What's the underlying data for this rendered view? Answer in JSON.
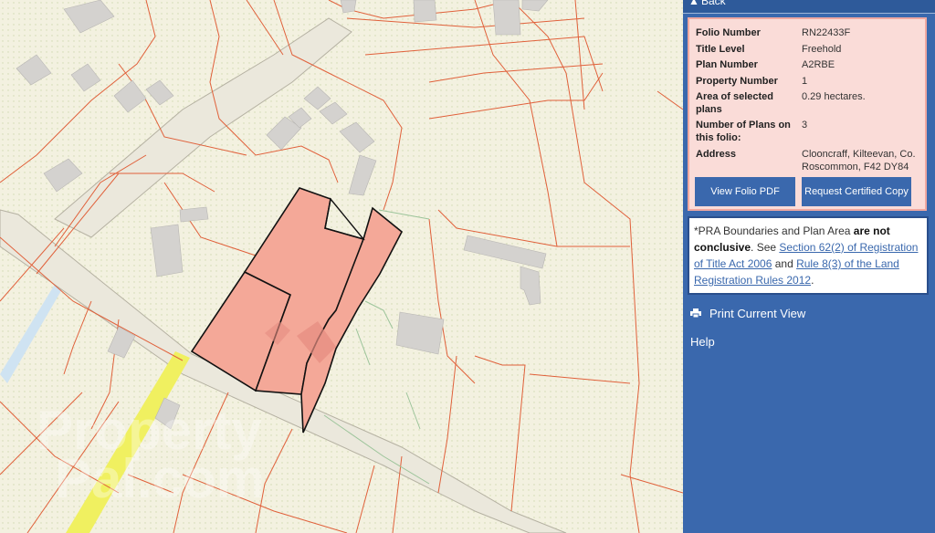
{
  "panel": {
    "back_label": "Back",
    "fields": [
      {
        "label": "Folio Number",
        "value": "RN22433F"
      },
      {
        "label": "Title Level",
        "value": "Freehold"
      },
      {
        "label": "Plan Number",
        "value": "A2RBE"
      },
      {
        "label": "Property Number",
        "value": "1"
      },
      {
        "label": "Area of selected plans",
        "value": "0.29 hectares."
      },
      {
        "label": "Number of Plans on this folio:",
        "value": "3"
      },
      {
        "label": "Address",
        "value": "Clooncraff, Kilteevan, Co. Roscommon, F42 DY84"
      }
    ],
    "view_folio_button": "View Folio PDF",
    "request_copy_button": "Request Certified Copy",
    "notice": {
      "prefix": "*PRA Boundaries and Plan Area ",
      "bold": "are not conclusive",
      "mid": ". See ",
      "link1": "Section 62(2) of Registration of Title Act 2006",
      "and": " and ",
      "link2": "Rule 8(3) of the Land Registration Rules 2012",
      "end": "."
    },
    "print_label": "Print Current View",
    "help_label": "Help"
  },
  "map": {
    "watermark_line1": "Property",
    "watermark_line2": "Pal.com"
  },
  "colors": {
    "panel_bg": "#3a68ad",
    "info_bg": "#fadcd8",
    "parcel_fill": "#f4a898",
    "boundary": "#e0603a",
    "road": "#f0f060",
    "map_bg": "#f3f1e0"
  },
  "icons": [
    "chevron-up-icon",
    "printer-icon"
  ]
}
